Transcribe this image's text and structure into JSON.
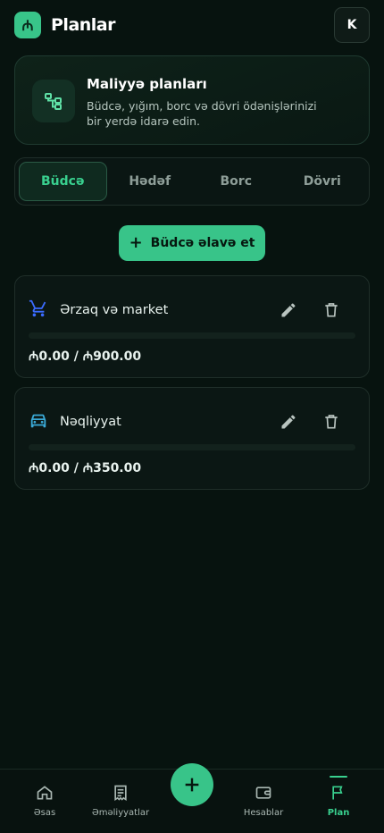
{
  "header": {
    "logo_glyph": "₼",
    "title": "Planlar",
    "avatar_initial": "K"
  },
  "info": {
    "title": "Maliyyə planları",
    "description": "Büdcə, yığım, borc və dövri ödənişlərinizi bir yerdə idarə edin."
  },
  "tabs": [
    {
      "label": "Büdcə",
      "active": true
    },
    {
      "label": "Hədəf",
      "active": false
    },
    {
      "label": "Borc",
      "active": false
    },
    {
      "label": "Dövri",
      "active": false
    }
  ],
  "add_button": {
    "icon": "+",
    "label": "Büdcə əlavə et"
  },
  "budgets": [
    {
      "name": "Ərzaq və market",
      "icon": "cart-icon",
      "amount": "₼0.00 / ₼900.00",
      "progress": 0
    },
    {
      "name": "Nəqliyyat",
      "icon": "car-icon",
      "amount": "₼0.00 / ₼350.00",
      "progress": 0
    }
  ],
  "nav": [
    {
      "label": "Əsas",
      "icon": "home-icon"
    },
    {
      "label": "Əməliyyatlar",
      "icon": "receipt-icon"
    },
    {
      "label": "Hesablar",
      "icon": "wallet-icon"
    },
    {
      "label": "Plan",
      "icon": "flag-icon",
      "active": true
    }
  ],
  "colors": {
    "accent": "#38c489",
    "background": "#07130f",
    "cart_icon": "#3b6bff",
    "car_icon": "#3aa9d6"
  }
}
